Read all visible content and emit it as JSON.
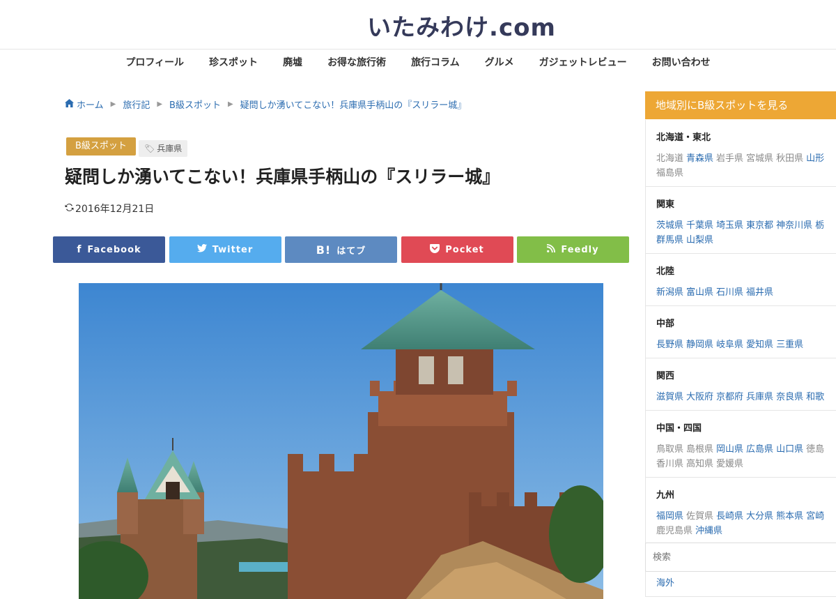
{
  "site": {
    "title": "いたみわけ.com"
  },
  "nav": [
    "プロフィール",
    "珍スポット",
    "廃墟",
    "お得な旅行術",
    "旅行コラム",
    "グルメ",
    "ガジェットレビュー",
    "お問い合わせ"
  ],
  "breadcrumb": {
    "home": "ホーム",
    "items": [
      "旅行記",
      "B級スポット",
      "疑問しか湧いてこない！兵庫県手柄山の『スリラー城』"
    ]
  },
  "post": {
    "category": "B級スポット",
    "tag": "兵庫県",
    "title": "疑問しか湧いてこない！兵庫県手柄山の『スリラー城』",
    "date": "2016年12月21日"
  },
  "share": {
    "facebook": "Facebook",
    "twitter": "Twitter",
    "hatena_icon": "B!",
    "hatena": "はてブ",
    "pocket": "Pocket",
    "feedly": "Feedly"
  },
  "sidebar": {
    "heading": "地域別にB級スポットを見る",
    "regions": [
      {
        "name": "北海道・東北",
        "lines": [
          [
            {
              "t": "北海道",
              "link": false
            },
            {
              "t": "青森県",
              "link": true
            },
            {
              "t": "岩手県",
              "link": false
            },
            {
              "t": "宮城県",
              "link": false
            },
            {
              "t": "秋田県",
              "link": false
            },
            {
              "t": "山形",
              "link": true
            }
          ],
          [
            {
              "t": "福島県",
              "link": false
            }
          ]
        ]
      },
      {
        "name": "関東",
        "lines": [
          [
            {
              "t": "茨城県",
              "link": true
            },
            {
              "t": "千葉県",
              "link": true
            },
            {
              "t": "埼玉県",
              "link": true
            },
            {
              "t": "東京都",
              "link": true
            },
            {
              "t": "神奈川県",
              "link": true
            },
            {
              "t": "栃",
              "link": true
            }
          ],
          [
            {
              "t": "群馬県",
              "link": true
            },
            {
              "t": "山梨県",
              "link": true
            }
          ]
        ]
      },
      {
        "name": "北陸",
        "lines": [
          [
            {
              "t": "新潟県",
              "link": true
            },
            {
              "t": "富山県",
              "link": true
            },
            {
              "t": "石川県",
              "link": true
            },
            {
              "t": "福井県",
              "link": true
            }
          ]
        ]
      },
      {
        "name": "中部",
        "lines": [
          [
            {
              "t": "長野県",
              "link": true
            },
            {
              "t": "静岡県",
              "link": true
            },
            {
              "t": "岐阜県",
              "link": true
            },
            {
              "t": "愛知県",
              "link": true
            },
            {
              "t": "三重県",
              "link": true
            }
          ]
        ]
      },
      {
        "name": "関西",
        "lines": [
          [
            {
              "t": "滋賀県",
              "link": true
            },
            {
              "t": "大阪府",
              "link": true
            },
            {
              "t": "京都府",
              "link": true
            },
            {
              "t": "兵庫県",
              "link": true
            },
            {
              "t": "奈良県",
              "link": true
            },
            {
              "t": "和歌",
              "link": true
            }
          ]
        ]
      },
      {
        "name": "中国・四国",
        "lines": [
          [
            {
              "t": "鳥取県",
              "link": false
            },
            {
              "t": "島根県",
              "link": false
            },
            {
              "t": "岡山県",
              "link": true
            },
            {
              "t": "広島県",
              "link": true
            },
            {
              "t": "山口県",
              "link": true
            },
            {
              "t": "徳島",
              "link": false
            }
          ],
          [
            {
              "t": "香川県",
              "link": false
            },
            {
              "t": "高知県",
              "link": false
            },
            {
              "t": "愛媛県",
              "link": false
            }
          ]
        ]
      },
      {
        "name": "九州",
        "lines": [
          [
            {
              "t": "福岡県",
              "link": true
            },
            {
              "t": "佐賀県",
              "link": false
            },
            {
              "t": "長崎県",
              "link": true
            },
            {
              "t": "大分県",
              "link": true
            },
            {
              "t": "熊本県",
              "link": true
            },
            {
              "t": "宮崎",
              "link": true
            }
          ],
          [
            {
              "t": "鹿児島県",
              "link": false
            },
            {
              "t": "沖縄県",
              "link": true
            }
          ]
        ]
      },
      {
        "name": "海外",
        "lines": [
          [
            {
              "t": "海外",
              "link": true
            }
          ]
        ]
      }
    ],
    "search_placeholder": "検索"
  },
  "colors": {
    "category": "#d4a040",
    "sidebar_head": "#eda735",
    "facebook": "#3b5998",
    "twitter": "#55acee",
    "hatena": "#5d8ac1",
    "pocket": "#e04a55",
    "feedly": "#82be48",
    "link": "#2b6cb0"
  }
}
